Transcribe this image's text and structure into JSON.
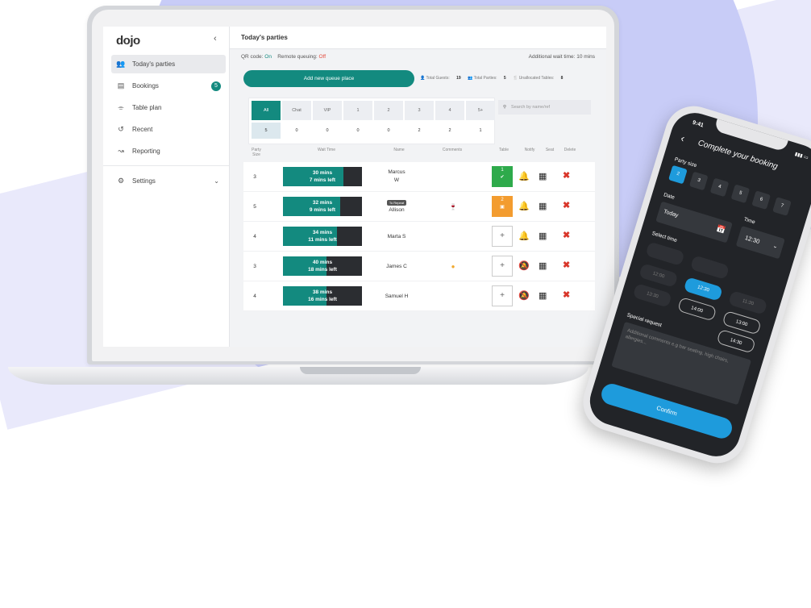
{
  "sidebar": {
    "logo": "dojo",
    "collapse": "‹",
    "items": [
      {
        "label": "Today's parties",
        "icon": "people-icon"
      },
      {
        "label": "Bookings",
        "icon": "calendar-icon",
        "badge": "5"
      },
      {
        "label": "Table plan",
        "icon": "table-icon"
      },
      {
        "label": "Recent",
        "icon": "history-icon"
      },
      {
        "label": "Reporting",
        "icon": "chart-line-icon"
      },
      {
        "label": "Settings",
        "icon": "gear-icon"
      }
    ]
  },
  "main": {
    "title": "Today's parties",
    "qr_label": "QR code:",
    "qr_value": "On",
    "remote_label": "Remote queuing:",
    "remote_value": "Off",
    "additional_wait": "Additional wait time: 10 mins",
    "add_button": "Add new queue place",
    "stats": {
      "guests_label": "Total Guests:",
      "guests": "19",
      "parties_label": "Total Parties:",
      "parties": "5",
      "unallocated_label": "Unallocated Tables:",
      "unallocated": "8"
    },
    "filters": {
      "labels": [
        "All",
        "Chat",
        "VIP",
        "1",
        "2",
        "3",
        "4",
        "5+"
      ],
      "counts": [
        "5",
        "0",
        "0",
        "0",
        "0",
        "2",
        "2",
        "1"
      ]
    },
    "search_placeholder": "Search by name/ref",
    "columns": [
      "Party Size",
      "Wait Time",
      "Name",
      "Comments",
      "Table",
      "Notify",
      "Seat",
      "Delete"
    ],
    "rows": [
      {
        "size": "3",
        "wait": "30 mins",
        "left": "7 mins left",
        "progress": 0.77,
        "name1": "Marcus",
        "name2": "W",
        "table": "1",
        "table_state": "seated",
        "notify": "bell-icon"
      },
      {
        "size": "5",
        "wait": "32 mins",
        "left": "9 mins left",
        "progress": 0.72,
        "name1": "Allison",
        "tag": "To Repeat",
        "comment": "wine-icon",
        "table": "2",
        "table_state": "assigned",
        "notify": "bell-icon"
      },
      {
        "size": "4",
        "wait": "34 mins",
        "left": "11 mins left",
        "progress": 0.68,
        "name1": "Marta S",
        "table": "+",
        "table_state": "empty",
        "notify": "bell-icon"
      },
      {
        "size": "3",
        "wait": "40 mins",
        "left": "18 mins left",
        "progress": 0.55,
        "name1": "James C",
        "comment": "emoji-icon",
        "table": "+",
        "table_state": "empty",
        "notify": "bell-off-icon"
      },
      {
        "size": "4",
        "wait": "38 mins",
        "left": "16 mins left",
        "progress": 0.55,
        "name1": "Samuel H",
        "table": "+",
        "table_state": "empty",
        "notify": "bell-off-icon"
      }
    ]
  },
  "phone": {
    "time": "9:41",
    "title": "Complete your booking",
    "party_size_label": "Party size",
    "sizes": [
      "2",
      "3",
      "4",
      "5",
      "6",
      "7"
    ],
    "selected_size": "2",
    "date_label": "Date",
    "date_value": "Today",
    "time_label": "Time",
    "time_value": "12:30",
    "select_time_label": "Select time",
    "slots": [
      "12:00",
      "12:30",
      "11:30",
      "13:30",
      "14:00",
      "13:00",
      "14:30"
    ],
    "request_label": "Special request",
    "request_placeholder": "Additional comments e.g bar seating, high chairs, allergies...",
    "confirm": "Confirm"
  },
  "colors": {
    "accent": "#138a7f",
    "phone_accent": "#1e9bdc",
    "background_circle": "#c8ccf7"
  }
}
